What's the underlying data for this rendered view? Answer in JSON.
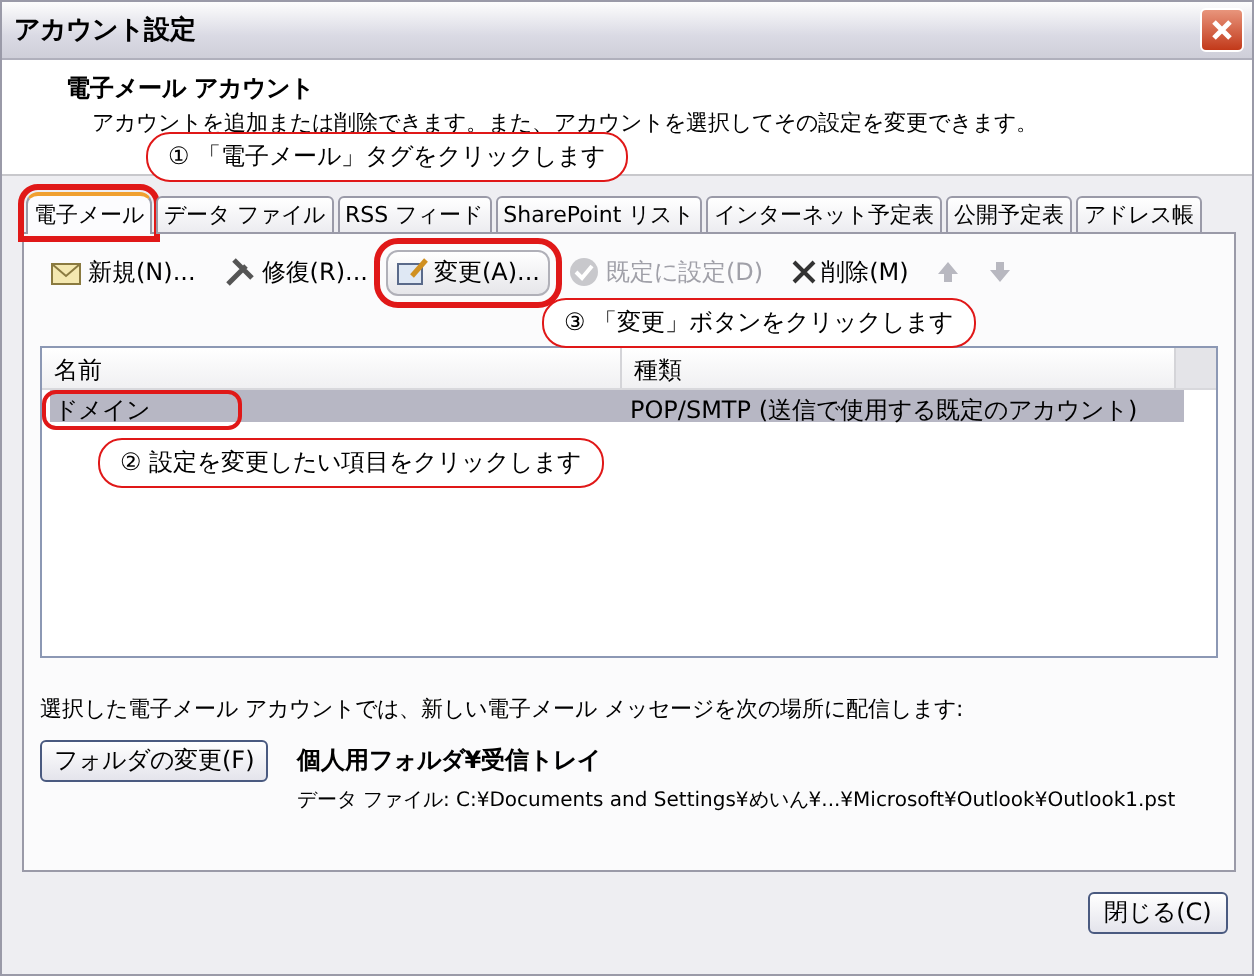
{
  "window": {
    "title": "アカウント設定"
  },
  "header": {
    "title": "電子メール アカウント",
    "description": "アカウントを追加または削除できます。また、アカウントを選択してその設定を変更できます。"
  },
  "tabs": [
    {
      "label": "電子メール",
      "selected": true,
      "highlighted": true
    },
    {
      "label": "データ ファイル",
      "selected": false,
      "highlighted": false
    },
    {
      "label": "RSS フィード",
      "selected": false,
      "highlighted": false
    },
    {
      "label": "SharePoint リスト",
      "selected": false,
      "highlighted": false
    },
    {
      "label": "インターネット予定表",
      "selected": false,
      "highlighted": false
    },
    {
      "label": "公開予定表",
      "selected": false,
      "highlighted": false
    },
    {
      "label": "アドレス帳",
      "selected": false,
      "highlighted": false
    }
  ],
  "toolbar": [
    {
      "kind": "new",
      "label": "新規(N)...",
      "disabled": false,
      "highlighted": false
    },
    {
      "kind": "repair",
      "label": "修復(R)...",
      "disabled": false,
      "highlighted": false
    },
    {
      "kind": "change",
      "label": "変更(A)...",
      "disabled": false,
      "highlighted": true
    },
    {
      "kind": "default",
      "label": "既定に設定(D)",
      "disabled": true,
      "highlighted": false
    },
    {
      "kind": "delete",
      "label": "削除(M)",
      "disabled": false,
      "highlighted": false
    },
    {
      "kind": "up",
      "disabled": true,
      "highlighted": false
    },
    {
      "kind": "down",
      "disabled": true,
      "highlighted": false
    }
  ],
  "account_list": {
    "columns": [
      "名前",
      "種類"
    ],
    "rows": [
      {
        "cells": [
          "ドメイン",
          "POP/SMTP (送信で使用する既定のアカウント)"
        ],
        "selected": true,
        "highlighted": true
      }
    ]
  },
  "delivery": {
    "text": "選択した電子メール アカウントでは、新しい電子メール メッセージを次の場所に配信します:",
    "button": "フォルダの変更(F)",
    "folder": "個人用フォルダ¥受信トレイ",
    "data_file": "データ ファイル: C:¥Documents and Settings¥めいん¥...¥Microsoft¥Outlook¥Outlook1.pst"
  },
  "close_button": "閉じる(C)",
  "callouts": [
    {
      "text": "① 「電子メール」タグをクリックします"
    },
    {
      "text": "② 設定を変更したい項目をクリックします"
    },
    {
      "text": "③ 「変更」ボタンをクリックします"
    }
  ]
}
